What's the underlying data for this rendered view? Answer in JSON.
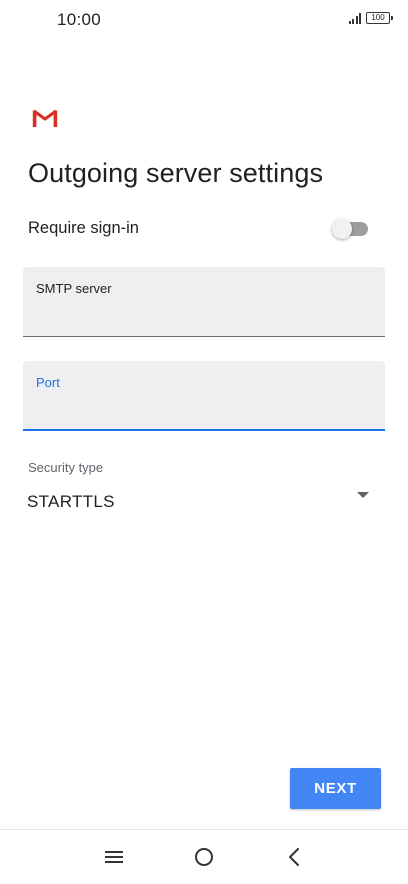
{
  "status_bar": {
    "time": "10:00",
    "battery": "100"
  },
  "header": {
    "logo_icon": "gmail-logo",
    "title": "Outgoing server settings"
  },
  "require_sign_in": {
    "label": "Require sign-in",
    "enabled": false
  },
  "smtp_server": {
    "label": "SMTP server",
    "value": ""
  },
  "port": {
    "label": "Port",
    "value": "",
    "focused": true
  },
  "security_type": {
    "label": "Security type",
    "value": "STARTTLS"
  },
  "actions": {
    "next_label": "NEXT"
  },
  "nav": {
    "menu_icon": "menu-icon",
    "home_icon": "home-icon",
    "back_icon": "back-icon"
  },
  "colors": {
    "accent": "#1a73e8",
    "button": "#4285f4",
    "field_bg": "#efeff1",
    "gmail_red": "#d93025"
  }
}
